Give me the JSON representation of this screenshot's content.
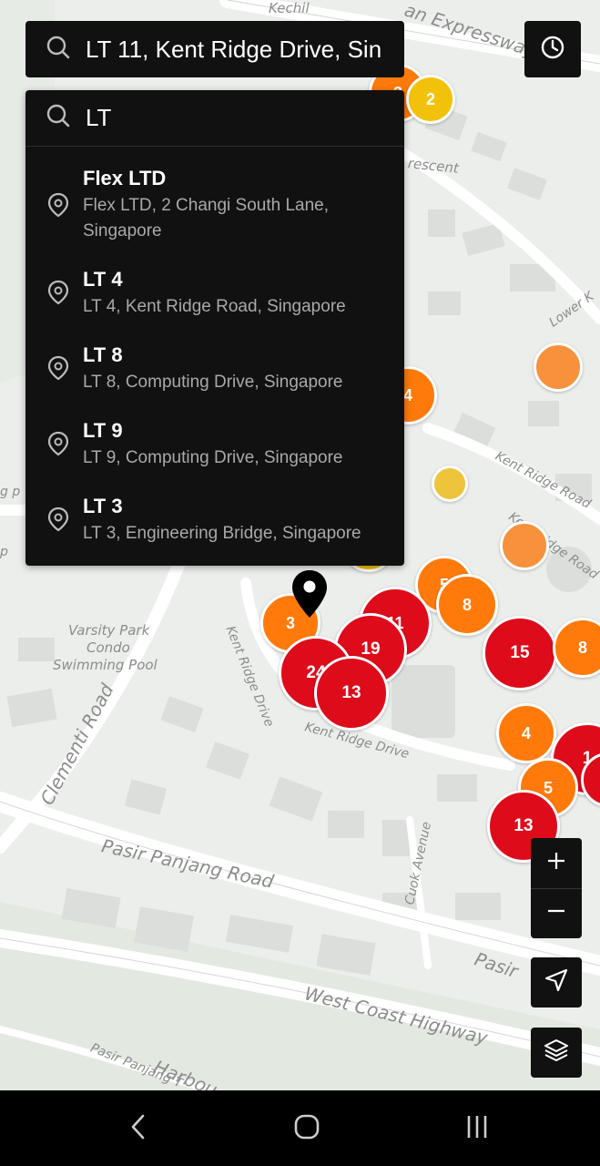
{
  "search": {
    "current_value": "LT 11, Kent Ridge Drive, Sin",
    "query": "LT",
    "icon": "search-icon"
  },
  "history_button": {
    "icon": "clock-icon"
  },
  "results": [
    {
      "title": "Flex LTD",
      "address": "Flex LTD, 2 Changi South Lane, Singapore"
    },
    {
      "title": "LT 4",
      "address": "LT 4, Kent Ridge Road, Singapore"
    },
    {
      "title": "LT 8",
      "address": "LT 8, Computing Drive, Singapore"
    },
    {
      "title": "LT 9",
      "address": "LT 9, Computing Drive, Singapore"
    },
    {
      "title": "LT 3",
      "address": "LT 3, Engineering Bridge, Singapore"
    }
  ],
  "map_labels": {
    "kechil": "Kechil",
    "expressway": "an Expressway",
    "crescent": "rescent",
    "lower_kent": "Lower K",
    "kent_ridge_road": "Kent Ridge Road",
    "kent_ridge_road2": "Kent Ridge Road",
    "kent_ridge_drive_v": "Kent Ridge Drive",
    "kent_ridge_drive_h": "Kent Ridge Drive",
    "varsity_park": "Varsity Park",
    "condo": "Condo",
    "swimming_pool": "Swimming Pool",
    "clementi_road": "Clementi Road",
    "pasir_panjang_road": "Pasir Panjang Road",
    "cuok_avenue": "Cuok Avenue",
    "pasir": "Pasir",
    "west_coast_highway": "West Coast Highway",
    "pasir_panjang_t": "Pasir Panjang T",
    "harbour": "Harbou",
    "left_gp": "g p",
    "left_p": "p"
  },
  "clusters": [
    {
      "label": "3",
      "color": "orange"
    },
    {
      "label": "2",
      "color": "yellow"
    },
    {
      "label": "4",
      "color": "orange"
    },
    {
      "label": "",
      "color": "lightorange"
    },
    {
      "label": "",
      "color": "lightyellow"
    },
    {
      "label": "",
      "color": "lightorange"
    },
    {
      "label": "",
      "color": "yellow"
    },
    {
      "label": "5",
      "color": "orange"
    },
    {
      "label": "8",
      "color": "orange"
    },
    {
      "label": "11",
      "color": "red"
    },
    {
      "label": "3",
      "color": "orange"
    },
    {
      "label": "15",
      "color": "red"
    },
    {
      "label": "8",
      "color": "orange"
    },
    {
      "label": "19",
      "color": "red"
    },
    {
      "label": "24",
      "color": "red"
    },
    {
      "label": "13",
      "color": "red"
    },
    {
      "label": "4",
      "color": "orange"
    },
    {
      "label": "1",
      "color": "red"
    },
    {
      "label": "",
      "color": "red"
    },
    {
      "label": "5",
      "color": "orange"
    },
    {
      "label": "13",
      "color": "red"
    }
  ],
  "colors": {
    "red": "#de0b1b",
    "orange": "#ff7a0a",
    "yellow": "#f2c20a",
    "panel": "#111111"
  },
  "controls": {
    "zoom_in_icon": "plus-icon",
    "zoom_out_icon": "minus-icon",
    "locate_icon": "navigation-arrow-icon",
    "layers_icon": "layers-icon"
  },
  "android_nav": {
    "back_icon": "back-chevron-icon",
    "home_icon": "home-circle-icon",
    "recents_icon": "recents-icon"
  }
}
